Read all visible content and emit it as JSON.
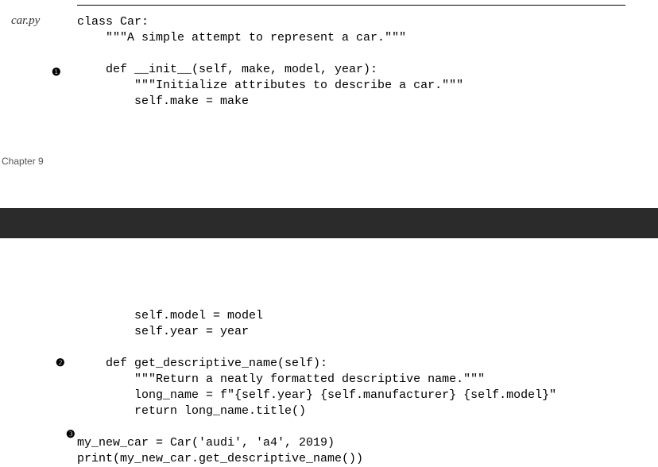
{
  "filename": "car.py",
  "chapter": "Chapter 9",
  "bullets": {
    "one": "❶",
    "two": "❷",
    "three": "❸"
  },
  "code": {
    "block1": "class Car:\n    \"\"\"A simple attempt to represent a car.\"\"\"\n\n    def __init__(self, make, model, year):\n        \"\"\"Initialize attributes to describe a car.\"\"\"\n        self.make = make",
    "block2": "        self.model = model\n        self.year = year\n\n    def get_descriptive_name(self):\n        \"\"\"Return a neatly formatted descriptive name.\"\"\"\n        long_name = f\"{self.year} {self.manufacturer} {self.model}\"\n        return long_name.title()\n\nmy_new_car = Car('audi', 'a4', 2019)\nprint(my_new_car.get_descriptive_name())"
  }
}
